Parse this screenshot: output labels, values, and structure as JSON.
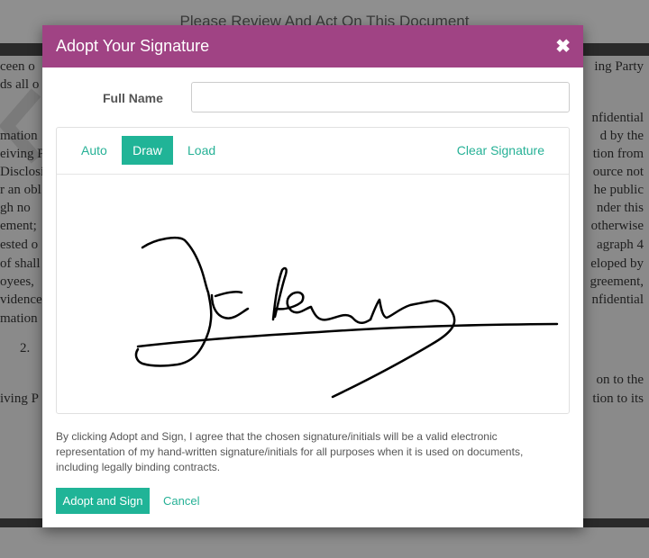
{
  "background": {
    "title": "Please Review And Act On This Document",
    "left_fragments": [
      "ceen o",
      "ds all o",
      "mation",
      "eiving P",
      "Disclosi",
      "r an obl",
      "gh no",
      "ement;",
      "ested o",
      "of shall",
      "oyees,",
      "vidence",
      "mation",
      "2.",
      "iving P"
    ],
    "right_fragments": [
      "ing Party",
      "nfidential",
      "d by the",
      "tion from",
      "ource not",
      "he public",
      "nder this",
      "otherwise",
      "agraph 4",
      "eloped by",
      "greement,",
      "nfidential",
      "on to the",
      "tion to its"
    ]
  },
  "dialog": {
    "title": "Adopt Your Signature",
    "close_glyph": "✖",
    "full_name_label": "Full Name",
    "full_name_value": "",
    "full_name_placeholder": "",
    "tabs": {
      "auto": "Auto",
      "draw": "Draw",
      "load": "Load",
      "active": "draw"
    },
    "clear_signature": "Clear Signature",
    "disclaimer": "By clicking Adopt and Sign, I agree that the chosen signature/initials will be a valid electronic representation of my hand-written signature/initials for all purposes when it is used on documents, including legally binding contracts.",
    "adopt_button": "Adopt and Sign",
    "cancel_link": "Cancel"
  },
  "colors": {
    "header": "#a04384",
    "accent": "#20b497",
    "overlay": "#8d8d8d"
  }
}
